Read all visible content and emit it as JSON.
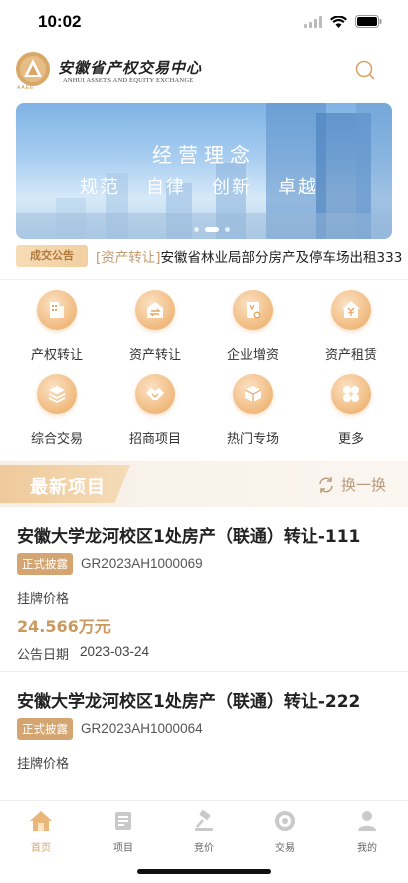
{
  "status_bar": {
    "time": "10:02"
  },
  "header": {
    "logo_text": "AAEE",
    "brand_cn": "安徽省产权交易中心",
    "brand_en": "ANHUI ASSETS AND EQUITY EXCHANGE",
    "search_icon": "search-icon"
  },
  "banner": {
    "title": "经营理念",
    "words": [
      "规范",
      "自律",
      "创新",
      "卓越"
    ],
    "active_slide": 2,
    "slide_count": 3
  },
  "notice": {
    "tag": "成交公告",
    "category": "[资产转让]",
    "text": "安徽省林业局部分房产及停车场出租333"
  },
  "quick_menu": [
    {
      "label": "产权转让",
      "icon": "property-transfer-icon"
    },
    {
      "label": "资产转让",
      "icon": "asset-transfer-icon"
    },
    {
      "label": "企业增资",
      "icon": "capital-increase-icon"
    },
    {
      "label": "资产租赁",
      "icon": "asset-lease-icon"
    },
    {
      "label": "综合交易",
      "icon": "comprehensive-trade-icon"
    },
    {
      "label": "招商项目",
      "icon": "investment-project-icon"
    },
    {
      "label": "热门专场",
      "icon": "hot-special-icon"
    },
    {
      "label": "更多",
      "icon": "more-icon"
    }
  ],
  "latest": {
    "title": "最新项目",
    "refresh_label": "换一换",
    "projects": [
      {
        "title": "安徽大学龙河校区1处房产（联通）转让-111",
        "badge": "正式披露",
        "code": "GR2023AH1000069",
        "price_label": "挂牌价格",
        "price": "24.566万元",
        "date_label": "公告日期",
        "date": "2023-03-24"
      },
      {
        "title": "安徽大学龙河校区1处房产（联通）转让-222",
        "badge": "正式披露",
        "code": "GR2023AH1000064",
        "price_label": "挂牌价格"
      }
    ]
  },
  "tabbar": {
    "items": [
      {
        "label": "首页",
        "icon": "home-icon",
        "active": true
      },
      {
        "label": "项目",
        "icon": "project-icon",
        "active": false
      },
      {
        "label": "竞价",
        "icon": "auction-gavel-icon",
        "active": false
      },
      {
        "label": "交易",
        "icon": "trade-icon",
        "active": false
      },
      {
        "label": "我的",
        "icon": "profile-icon",
        "active": false
      }
    ]
  },
  "colors": {
    "accent": "#d8a46a",
    "price": "#c9995f",
    "badge": "#d5a571"
  }
}
